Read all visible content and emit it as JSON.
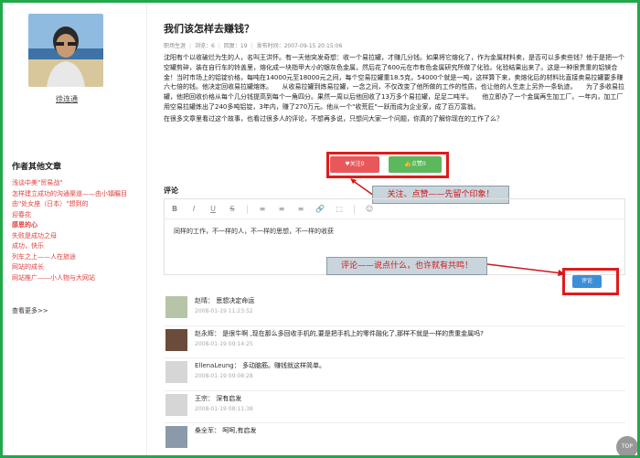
{
  "author": {
    "name": "徐连通"
  },
  "sidebar": {
    "heading": "作者其他文章",
    "articles": [
      "浅谈中美\"贸易战\"",
      "怎样建立成功的沟通渠道——由小镇瞩目",
      "由\"处女座（日本）\"想到的",
      "迎春花",
      "感恩的心",
      "失败是成功之母",
      "成功，快乐",
      "列车之上——人在旅途",
      "网站的成长",
      "网站推广——小人物与大网站"
    ],
    "more_label": "查看更多>>"
  },
  "article": {
    "title": "我们该怎样去赚钱？",
    "meta": {
      "category": "职场生涯",
      "views": "浏览：6",
      "replies": "回复：19",
      "published": "发布时间：2007-09-15 20:15:06"
    },
    "paragraphs": [
      "沈阳有个以收破烂为生的人，名叫王洪怀。有一天他突发奇想：收一个易拉罐，才赚几分钱。如果将它熔化了，作为金属材料卖，是否可以多卖些钱？他于是把一个空罐剪碎，装在自行车的铃盖里，熔化成一块指甲大小的银灰色金属，然后花了600元在市有色金属研究所做了化验。化验结果出来了。这是一种很贵重的铝镁合金！当时市场上的铝锭价格，每吨在14000元至18000元之间，每个空易拉罐重18.5克，54000个就是一吨，这样算下来，卖熔化后的材料比直接卖易拉罐要多赚六七倍的钱。他决定回收易拉罐熔炼。　　从收易拉罐到炼易拉罐，一念之间，不仅改变了他所做的工作的性质，也让他的人生走上另外一条轨迹。　　为了多收易拉罐，他把回收价格从每个几分钱提高到每个一角四分。果然一周以后他回收了13万多个易拉罐，足足二吨半。　　他立即办了一个金属再生加工厂。一年内，加工厂用空易拉罐炼出了240多吨铝锭，3年内，赚了270万元。他从一个\"收荒匠\"一跃而成为企业家，成了百万富翁。",
      "在很多文章里看过这个故事，也看过很多人的评论，不想再多说，只想问大家一个问题，你真的了解你现在的工作了么？"
    ]
  },
  "actions": {
    "like_label": "♥关注0",
    "agree_label": "👍点赞0",
    "callout_actions": "关注、点赞——先留个印象！"
  },
  "comment_form": {
    "heading": "评论",
    "toolbar": [
      "B",
      "I",
      "U",
      "S",
      "≡",
      "≡",
      "≡",
      "🔗",
      "⬚",
      "☺"
    ],
    "text": "同样的工作，不一样的人，不一样的思想，不一样的收获",
    "callout_comment": "评论——说点什么，也许就有共鸣！",
    "submit_label": "评论"
  },
  "comments": [
    {
      "name": "赵晴",
      "text": "思想决定命运",
      "time": "2008-01-19 11:23:52"
    },
    {
      "name": "赵永辉",
      "text": "是很牛啊 ,现在那么多回收手机的,要是把手机上的零件融化了,那样不就是一样的贵重金属吗?",
      "time": "2008-01-19 09:14:25"
    },
    {
      "name": "EllenaLeung",
      "text": "多动脑筋。赚钱就这样简单。",
      "time": "2008-01-19 09:08:28"
    },
    {
      "name": "王宗",
      "text": "深有启发",
      "time": "2008-01-19 08:11:38"
    },
    {
      "name": "桑全军",
      "text": "呵呵,有启发",
      "time": ""
    }
  ],
  "top_button": "TOP",
  "colors": {
    "frame": "#22a84a",
    "highlight_box": "#e01b1b",
    "link": "#e0403c",
    "like": "#e8585a",
    "agree": "#5cb85c",
    "submit": "#3b8fd9"
  }
}
